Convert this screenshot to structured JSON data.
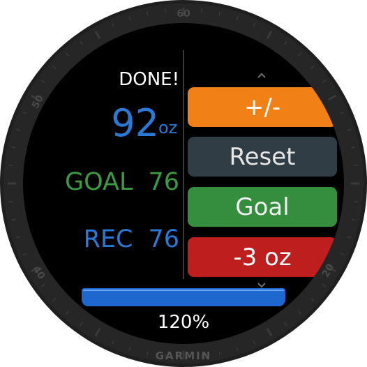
{
  "device": {
    "brand": "GARMIN",
    "bezel_numbers": {
      "top": "60",
      "upper_left": "50",
      "lower_left": "40",
      "lower_right": "20"
    }
  },
  "status": {
    "text": "DONE!"
  },
  "intake": {
    "amount": "92",
    "unit": "oz"
  },
  "goal": {
    "label": "GOAL",
    "value": "76"
  },
  "recommended": {
    "label": "REC",
    "value": "76"
  },
  "actions": {
    "adjust_label": "+/-",
    "reset_label": "Reset",
    "goal_label": "Goal",
    "decrement_label": "-3 oz"
  },
  "progress": {
    "percent_text": "120%",
    "fill_fraction": 1.0
  },
  "nav": {
    "up_icon": "chevron-up-icon",
    "down_icon": "chevron-down-icon"
  },
  "colors": {
    "intake_blue": "#2b79d6",
    "goal_green": "#3c9a43",
    "adjust_orange": "#f18017",
    "reset_gray": "#313d45",
    "goal_button_green": "#358e3e",
    "decrement_red": "#bf1e1e",
    "progress_blue": "#1d67cf"
  }
}
